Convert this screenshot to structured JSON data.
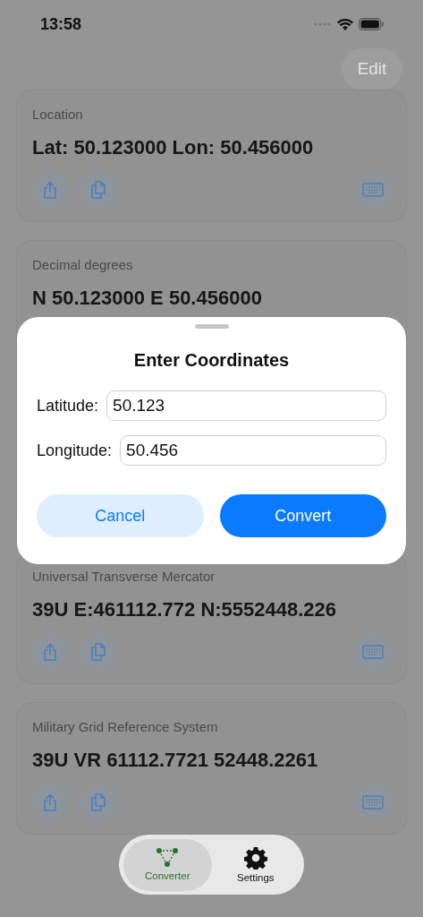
{
  "status_bar": {
    "time": "13:58"
  },
  "edit_button": {
    "label": "Edit",
    "disabled": true
  },
  "cards": [
    {
      "title": "Location",
      "value": "Lat: 50.123000 Lon: 50.456000",
      "actions": true
    },
    {
      "title": "Decimal degrees",
      "value": "N 50.123000 E 50.456000",
      "actions": false
    },
    {
      "title": "Universal Transverse Mercator",
      "value": "39U E:461112.772 N:5552448.226",
      "actions": true
    },
    {
      "title": "Military Grid Reference System",
      "value": "39U VR 61112.7721 52448.2261",
      "actions": true
    }
  ],
  "sheet": {
    "title": "Enter Coordinates",
    "fields": [
      {
        "label": "Latitude:",
        "value": "50.123"
      },
      {
        "label": "Longitude:",
        "value": "50.456"
      }
    ],
    "buttons": [
      {
        "label": "Cancel",
        "kind": "secondary"
      },
      {
        "label": "Convert",
        "kind": "primary"
      }
    ]
  },
  "tab_bar": [
    {
      "label": "Converter",
      "kind": "converter",
      "selected": true
    },
    {
      "label": "Settings",
      "kind": "settings",
      "selected": false
    }
  ]
}
